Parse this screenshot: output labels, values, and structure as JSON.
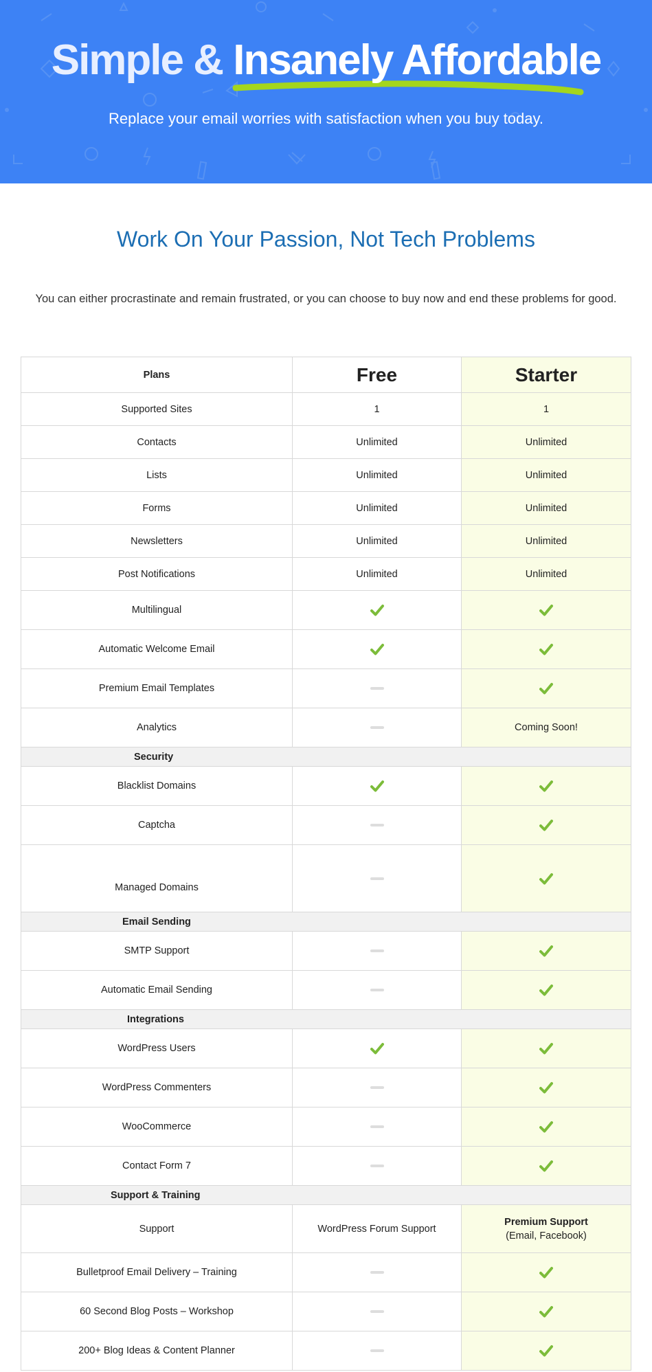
{
  "hero": {
    "title_part1": "Simple & ",
    "title_part2": "Insanely Affordable",
    "subtitle": "Replace your email worries with satisfaction when you buy today.",
    "bg_color": "#3d82f5",
    "underline_color": "#a4d61d"
  },
  "intro": {
    "title": "Work On Your Passion, Not Tech Problems",
    "text": "You can either procrastinate and remain frustrated, or you can choose to buy now and end these problems for good."
  },
  "table": {
    "header": {
      "label": "Plans",
      "free": "Free",
      "starter": "Starter"
    },
    "rows": [
      {
        "feature": "Supported Sites",
        "free": "1",
        "starter": "1"
      },
      {
        "feature": "Contacts",
        "free": "Unlimited",
        "starter": "Unlimited"
      },
      {
        "feature": "Lists",
        "free": "Unlimited",
        "starter": "Unlimited"
      },
      {
        "feature": "Forms",
        "free": "Unlimited",
        "starter": "Unlimited"
      },
      {
        "feature": "Newsletters",
        "free": "Unlimited",
        "starter": "Unlimited"
      },
      {
        "feature": "Post Notifications",
        "free": "Unlimited",
        "starter": "Unlimited"
      },
      {
        "feature": "Multilingual",
        "free": "check-icon",
        "starter": "check-icon"
      },
      {
        "feature": "Automatic Welcome Email",
        "free": "check-icon",
        "starter": "check-icon"
      },
      {
        "feature": "Premium Email Templates",
        "free": "dash-icon",
        "starter": "check-icon"
      },
      {
        "feature": "Analytics",
        "free": "dash-icon",
        "starter": "Coming Soon!"
      }
    ],
    "sections": [
      {
        "title": "Security",
        "rows": [
          {
            "feature": "Blacklist Domains",
            "free": "check-icon",
            "starter": "check-icon"
          },
          {
            "feature": "Captcha",
            "free": "dash-icon",
            "starter": "check-icon"
          },
          {
            "feature": "Managed Domains",
            "free": "dash-icon",
            "starter": "check-icon"
          }
        ]
      },
      {
        "title": "Email Sending",
        "rows": [
          {
            "feature": "SMTP Support",
            "free": "dash-icon",
            "starter": "check-icon"
          },
          {
            "feature": "Automatic Email Sending",
            "free": "dash-icon",
            "starter": "check-icon"
          }
        ]
      },
      {
        "title": "Integrations",
        "rows": [
          {
            "feature": "WordPress Users",
            "free": "check-icon",
            "starter": "check-icon"
          },
          {
            "feature": "WordPress Commenters",
            "free": "dash-icon",
            "starter": "check-icon"
          },
          {
            "feature": "WooCommerce",
            "free": "dash-icon",
            "starter": "check-icon"
          },
          {
            "feature": "Contact Form 7",
            "free": "dash-icon",
            "starter": "check-icon"
          }
        ]
      },
      {
        "title": "Support & Training",
        "rows": [
          {
            "feature": "Support",
            "free": "WordPress Forum Support",
            "starter_title": "Premium Support",
            "starter_sub": "(Email, Facebook)"
          },
          {
            "feature": "Bulletproof Email Delivery – Training",
            "free": "dash-icon",
            "starter": "check-icon"
          },
          {
            "feature": "60 Second Blog Posts – Workshop",
            "free": "dash-icon",
            "starter": "check-icon"
          },
          {
            "feature": "200+ Blog Ideas & Content Planner",
            "free": "dash-icon",
            "starter": "check-icon"
          }
        ]
      }
    ],
    "colors": {
      "starter_bg": "#fafde5",
      "section_bg": "#f1f1f1",
      "check": "#7cbc3a",
      "dash": "#dddddd"
    }
  }
}
